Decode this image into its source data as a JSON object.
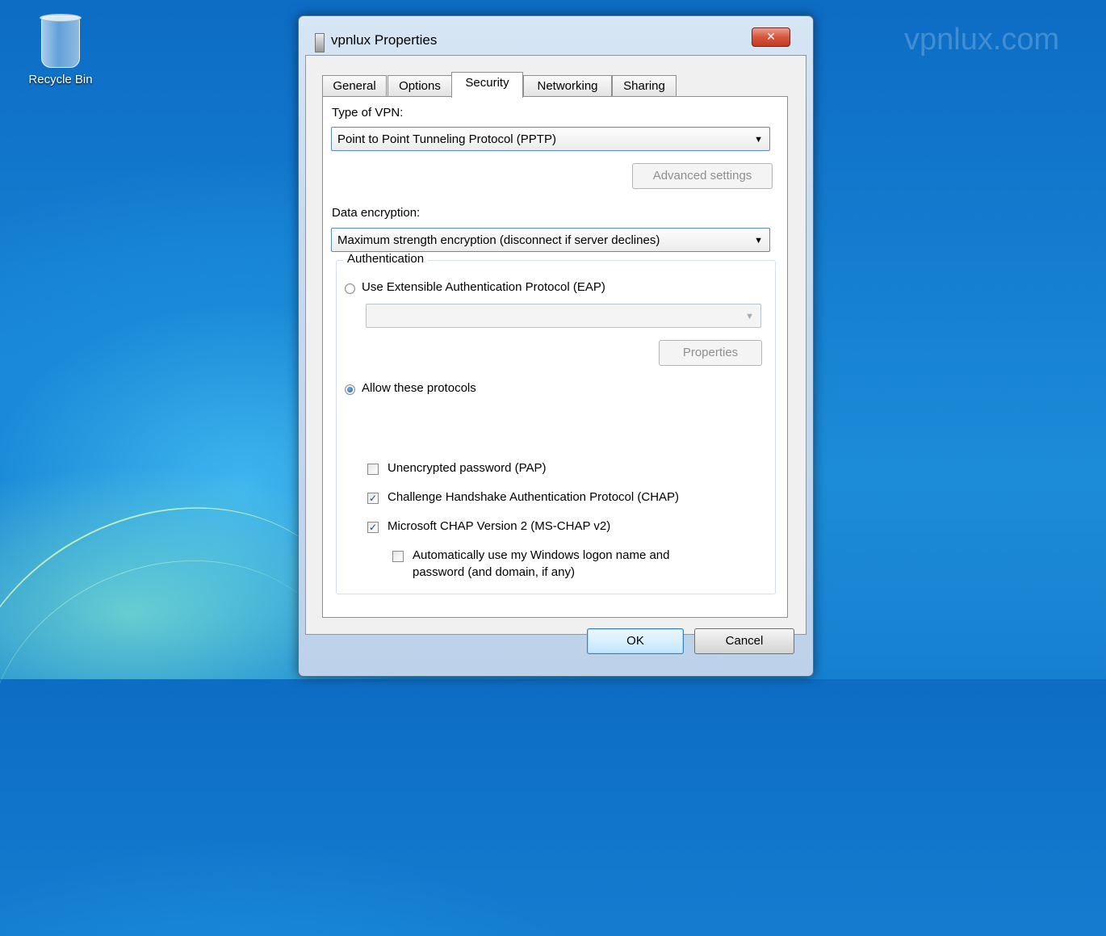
{
  "desktop": {
    "recycle_bin_label": "Recycle Bin",
    "watermark": "vpnlux.com"
  },
  "window": {
    "title": "vpnlux Properties",
    "close_glyph": "✕",
    "tabs": [
      {
        "label": "General",
        "active": false
      },
      {
        "label": "Options",
        "active": false
      },
      {
        "label": "Security",
        "active": true
      },
      {
        "label": "Networking",
        "active": false
      },
      {
        "label": "Sharing",
        "active": false
      }
    ]
  },
  "security": {
    "vpn_type_label": "Type of VPN:",
    "vpn_type_value": "Point to Point Tunneling Protocol (PPTP)",
    "advanced_settings_label": "Advanced settings",
    "encryption_label": "Data encryption:",
    "encryption_value": "Maximum strength encryption (disconnect if server declines)",
    "authentication": {
      "legend": "Authentication",
      "eap_label": "Use Extensible Authentication Protocol (EAP)",
      "eap_selected": false,
      "eap_combo_value": "",
      "properties_label": "Properties",
      "allow_label": "Allow these protocols",
      "allow_selected": true,
      "protocols": [
        {
          "label": "Unencrypted password (PAP)",
          "checked": false
        },
        {
          "label": "Challenge Handshake Authentication Protocol (CHAP)",
          "checked": true
        },
        {
          "label": "Microsoft CHAP Version 2 (MS-CHAP v2)",
          "checked": true
        }
      ],
      "auto_logon_line1": "Automatically use my Windows logon name and",
      "auto_logon_line2": "password (and domain, if any)",
      "auto_logon_checked": false
    }
  },
  "footer": {
    "ok_label": "OK",
    "cancel_label": "Cancel"
  },
  "glyphs": {
    "dropdown": "▼",
    "check": "✓"
  }
}
